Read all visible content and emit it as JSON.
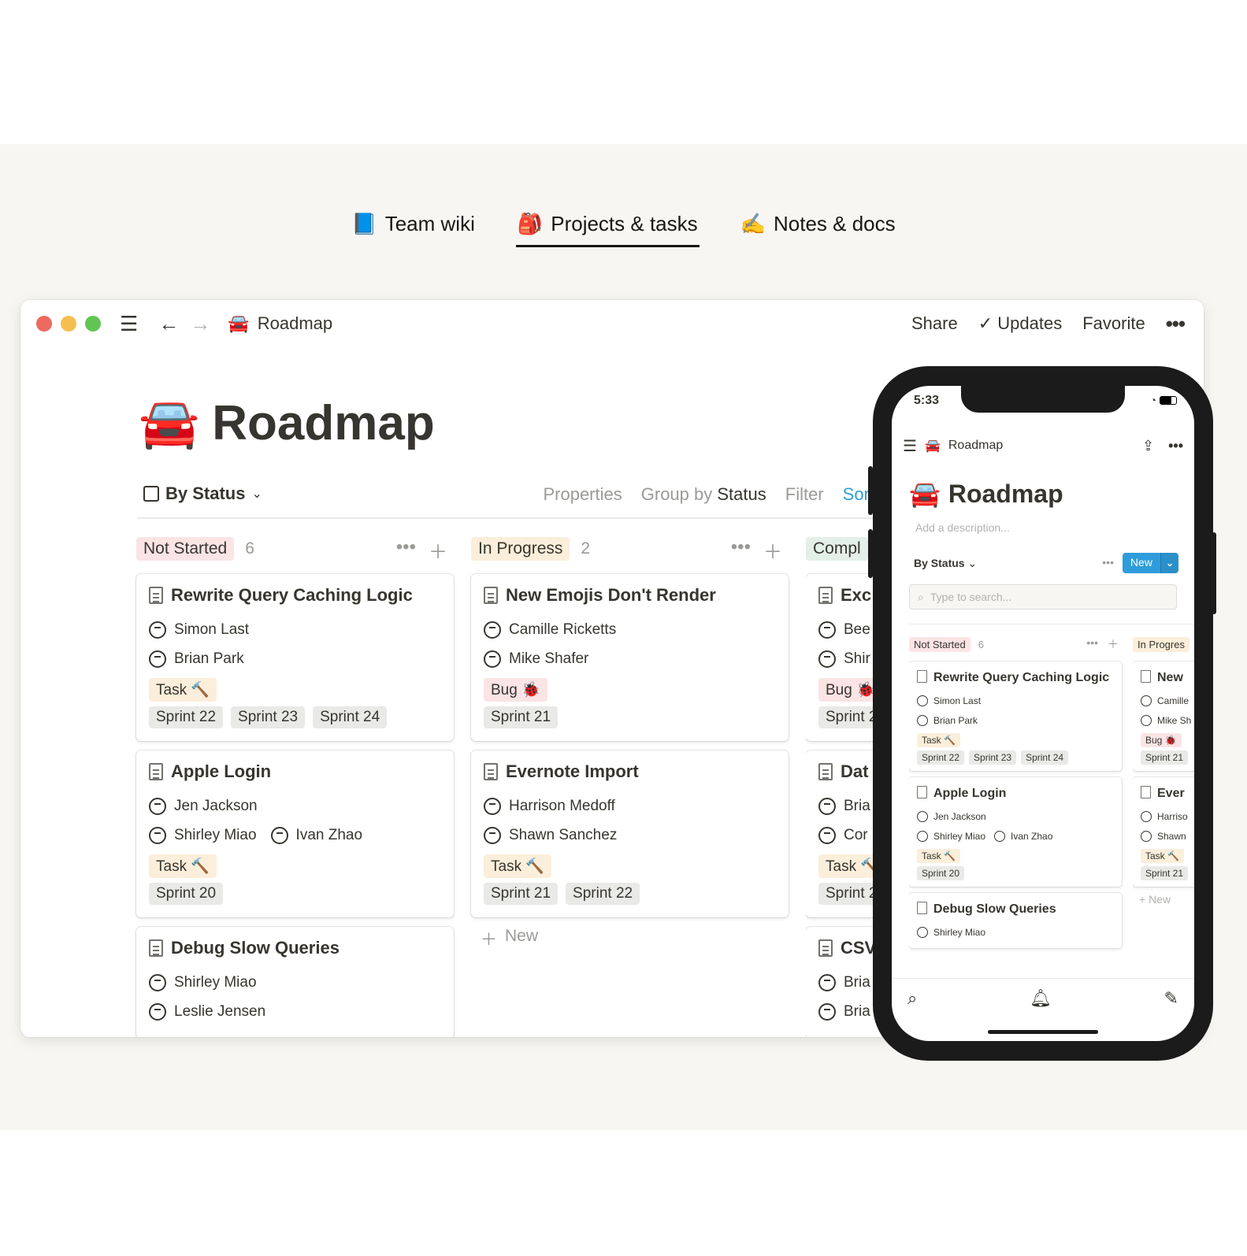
{
  "top_tabs": [
    {
      "emoji": "📘",
      "label": "Team wiki"
    },
    {
      "emoji": "🎒",
      "label": "Projects & tasks"
    },
    {
      "emoji": "✍️",
      "label": "Notes & docs"
    }
  ],
  "window": {
    "breadcrumb_emoji": "🚘",
    "breadcrumb": "Roadmap",
    "share": "Share",
    "updates": "Updates",
    "favorite": "Favorite",
    "more": "•••"
  },
  "page": {
    "emoji": "🚘",
    "title": "Roadmap",
    "view": "By Status",
    "actions": {
      "properties": "Properties",
      "group_by": "Group by",
      "group_value": "Status",
      "filter": "Filter",
      "sort": "Sort"
    }
  },
  "board": {
    "columns": [
      {
        "label": "Not Started",
        "count": "6",
        "cards": [
          {
            "title": "Rewrite Query Caching Logic",
            "people": [
              "Simon Last",
              "Brian Park"
            ],
            "type": "Task 🔨",
            "sprints": [
              "Sprint 22",
              "Sprint 23",
              "Sprint 24"
            ]
          },
          {
            "title": "Apple Login",
            "people": [
              "Jen Jackson"
            ],
            "people2": [
              "Shirley Miao",
              "Ivan Zhao"
            ],
            "type": "Task 🔨",
            "sprints": [
              "Sprint 20"
            ]
          },
          {
            "title": "Debug Slow Queries",
            "people": [
              "Shirley Miao",
              "Leslie Jensen"
            ]
          }
        ]
      },
      {
        "label": "In Progress",
        "count": "2",
        "cards": [
          {
            "title": "New Emojis Don't Render",
            "people": [
              "Camille Ricketts",
              "Mike Shafer"
            ],
            "type": "Bug 🐞",
            "sprints": [
              "Sprint 21"
            ]
          },
          {
            "title": "Evernote Import",
            "people": [
              "Harrison Medoff",
              "Shawn Sanchez"
            ],
            "type": "Task 🔨",
            "sprints": [
              "Sprint 21",
              "Sprint 22"
            ]
          }
        ],
        "new": "New"
      },
      {
        "label": "Compl",
        "cards": [
          {
            "title": "Exc",
            "people": [
              "Bee",
              "Shir"
            ],
            "type": "Bug 🐞",
            "sprints": [
              "Sprint 2"
            ]
          },
          {
            "title": "Dat",
            "people": [
              "Bria",
              "Cor"
            ],
            "type": "Task 🔨",
            "sprints": [
              "Sprint 2"
            ]
          },
          {
            "title": "CSV",
            "people": [
              "Bria",
              "Bria"
            ]
          }
        ]
      }
    ]
  },
  "phone": {
    "time": "5:33",
    "breadcrumb": "Roadmap",
    "emoji": "🚘",
    "title": "Roadmap",
    "description_placeholder": "Add a description...",
    "view": "By Status",
    "new": "New",
    "search_placeholder": "Type to search...",
    "columns": [
      {
        "label": "Not Started",
        "count": "6",
        "cards": [
          {
            "title": "Rewrite Query Caching Logic",
            "people": [
              "Simon Last",
              "Brian Park"
            ],
            "type": "Task 🔨",
            "sprints": [
              "Sprint 22",
              "Sprint 23",
              "Sprint 24"
            ]
          },
          {
            "title": "Apple Login",
            "people": [
              "Jen Jackson"
            ],
            "people2": [
              "Shirley Miao",
              "Ivan Zhao"
            ],
            "type": "Task 🔨",
            "sprints": [
              "Sprint 20"
            ]
          },
          {
            "title": "Debug Slow Queries",
            "people": [
              "Shirley Miao"
            ]
          }
        ]
      },
      {
        "label": "In Progres",
        "cards": [
          {
            "title": "New",
            "people": [
              "Camille",
              "Mike Sh"
            ],
            "type": "Bug 🐞",
            "sprints": [
              "Sprint 21"
            ]
          },
          {
            "title": "Ever",
            "people": [
              "Harriso",
              "Shawn"
            ],
            "type": "Task 🔨",
            "sprints": [
              "Sprint 21"
            ]
          }
        ],
        "new": "+ New"
      }
    ]
  }
}
